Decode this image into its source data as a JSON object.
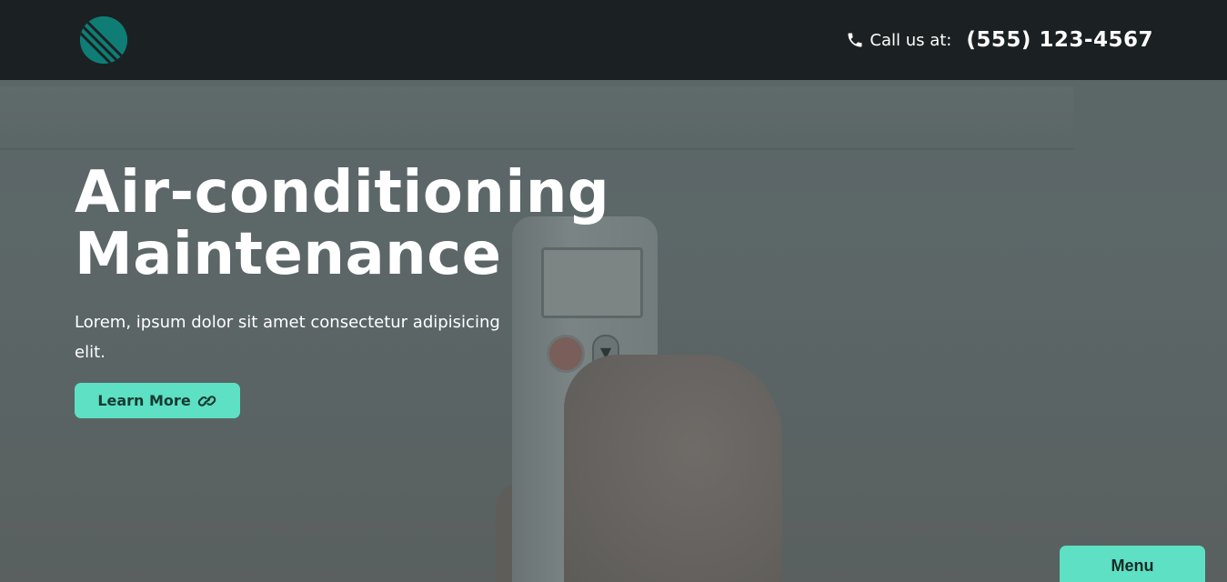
{
  "header": {
    "call_label": "Call us at:",
    "phone_number": "(555) 123-4567"
  },
  "hero": {
    "title_line1": "Air-conditioning",
    "title_line2": "Maintenance",
    "description": "Lorem, ipsum dolor sit amet consectetur adipisicing elit.",
    "cta_label": "Learn More"
  },
  "menu": {
    "label": "Menu"
  },
  "icons": {
    "logo": "striped-circle-logo",
    "phone": "phone-icon",
    "cta": "link-icon"
  },
  "colors": {
    "accent": "#5de0c3",
    "header_bg": "#1b2122",
    "logo": "#0f7d75"
  }
}
